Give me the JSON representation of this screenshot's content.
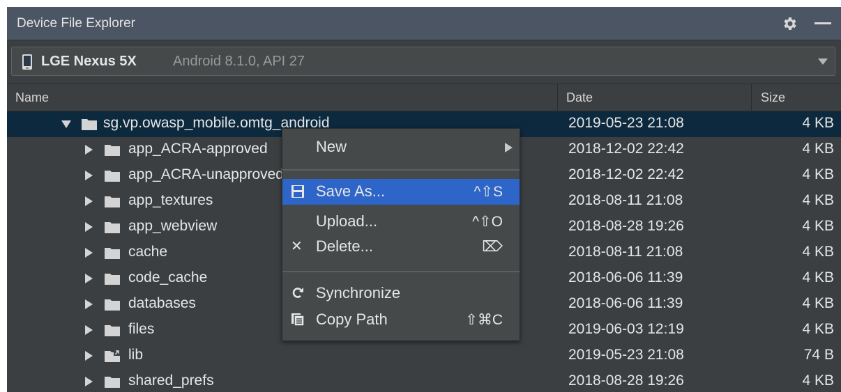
{
  "panel": {
    "title": "Device File Explorer",
    "gear_icon": "gear-icon",
    "minimize_icon": "minimize-icon"
  },
  "device": {
    "name": "LGE Nexus 5X",
    "details": "Android 8.1.0, API 27"
  },
  "columns": {
    "name": "Name",
    "date": "Date",
    "size": "Size"
  },
  "rows": [
    {
      "name": "sg.vp.owasp_mobile.omtg_android",
      "date": "2019-05-23 21:08",
      "size": "4 KB"
    },
    {
      "name": "app_ACRA-approved",
      "date": "2018-12-02 22:42",
      "size": "4 KB"
    },
    {
      "name": "app_ACRA-unapproved",
      "date": "2018-12-02 22:42",
      "size": "4 KB"
    },
    {
      "name": "app_textures",
      "date": "2018-08-11 21:08",
      "size": "4 KB"
    },
    {
      "name": "app_webview",
      "date": "2018-08-28 19:26",
      "size": "4 KB"
    },
    {
      "name": "cache",
      "date": "2018-08-11 21:08",
      "size": "4 KB"
    },
    {
      "name": "code_cache",
      "date": "2018-06-06 11:39",
      "size": "4 KB"
    },
    {
      "name": "databases",
      "date": "2018-06-06 11:39",
      "size": "4 KB"
    },
    {
      "name": "files",
      "date": "2019-06-03 12:19",
      "size": "4 KB"
    },
    {
      "name": "lib",
      "date": "2019-05-23 21:08",
      "size": "74 B"
    },
    {
      "name": "shared_prefs",
      "date": "2018-08-28 19:26",
      "size": "4 KB"
    }
  ],
  "context_menu": {
    "new": "New",
    "save_as": "Save As...",
    "save_as_shortcut": "^⇧S",
    "upload": "Upload...",
    "upload_shortcut": "^⇧O",
    "delete": "Delete...",
    "delete_shortcut": "⌦",
    "synchronize": "Synchronize",
    "copy_path": "Copy Path",
    "copy_path_shortcut": "⇧⌘C"
  },
  "colors": {
    "selection": "#0d293e",
    "menu_highlight": "#2e65c8",
    "folder": "#d4d4d4"
  }
}
